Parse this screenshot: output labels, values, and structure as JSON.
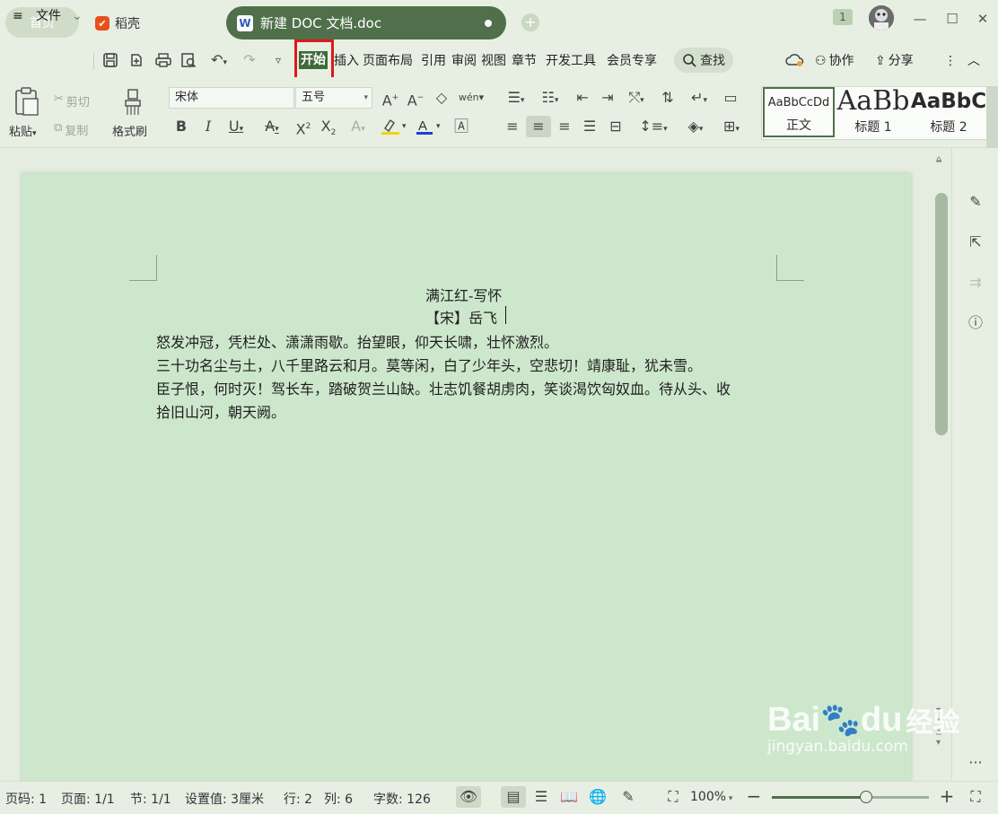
{
  "titlebar": {
    "home_tab": "首页",
    "daoke_tab": "稻壳",
    "doc_tab": "新建 DOC 文档.doc",
    "w_logo": "W",
    "add_tab": "+",
    "badge": "1"
  },
  "menu": {
    "file": "文件",
    "items": [
      "开始",
      "插入",
      "页面布局",
      "引用",
      "审阅",
      "视图",
      "章节",
      "开发工具",
      "会员专享"
    ],
    "search": "查找",
    "collab": "协作",
    "share": "分享"
  },
  "ribbon": {
    "paste": "粘贴",
    "cut": "剪切",
    "copy": "复制",
    "format_painter": "格式刷",
    "font_name": "宋体",
    "font_size": "五号",
    "styles": [
      {
        "preview": "AaBbCcDd",
        "label": "正文"
      },
      {
        "preview": "AaBb",
        "label": "标题 1"
      },
      {
        "preview": "AaBbC",
        "label": "标题 2"
      }
    ]
  },
  "document": {
    "title": "满江红-写怀",
    "author": "【宋】岳飞",
    "lines": [
      "怒发冲冠，凭栏处、潇潇雨歇。抬望眼，仰天长啸，壮怀激烈。",
      "三十功名尘与土，八千里路云和月。莫等闲，白了少年头，空悲切！靖康耻，犹未雪。",
      "臣子恨，何时灭！驾长车，踏破贺兰山缺。壮志饥餐胡虏肉，笑谈渴饮匈奴血。待从头、收",
      "拾旧山河，朝天阙。"
    ]
  },
  "status": {
    "page_no": "页码: 1",
    "pages": "页面: 1/1",
    "section": "节: 1/1",
    "setting": "设置值: 3厘米",
    "row": "行: 2",
    "col": "列: 6",
    "words": "字数: 126",
    "zoom": "100%",
    "zoom_level": 0.6
  },
  "watermark": {
    "brand": "Bai",
    "brand2": "du",
    "cn": "经验",
    "url": "jingyan.baidu.com"
  },
  "colors": {
    "accent": "#4f704a",
    "highlight": "#e01818",
    "page_bg": "#cde7cc"
  }
}
